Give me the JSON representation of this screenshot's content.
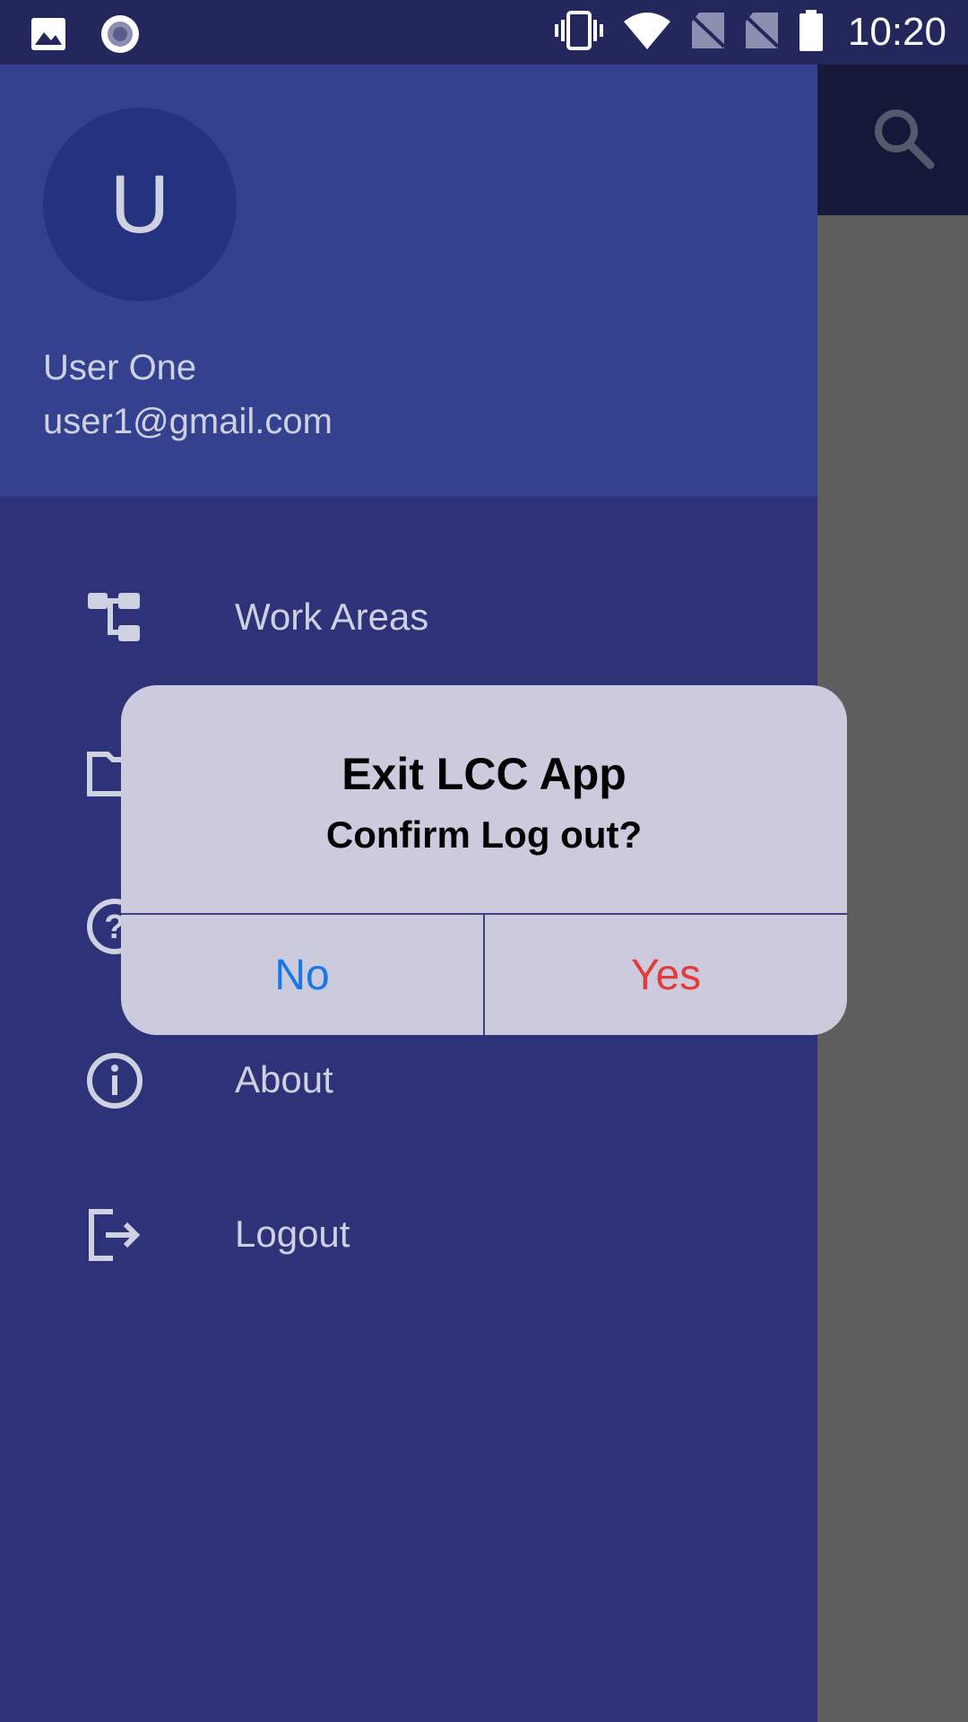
{
  "status_bar": {
    "time": "10:20",
    "icons": [
      "image-icon",
      "record-icon",
      "vibrate-icon",
      "wifi-icon",
      "no-sim-icon",
      "no-sim-icon",
      "battery-icon"
    ]
  },
  "app_bar": {
    "search_icon": "search-icon"
  },
  "drawer": {
    "avatar_letter": "U",
    "user_name": "User One",
    "user_email": "user1@gmail.com",
    "items": [
      {
        "label": "Work Areas",
        "icon": "tree-icon"
      },
      {
        "label": "",
        "icon": "folder-icon"
      },
      {
        "label": "",
        "icon": "help-icon"
      },
      {
        "label": "About",
        "icon": "info-icon"
      },
      {
        "label": "Logout",
        "icon": "logout-icon"
      }
    ]
  },
  "dialog": {
    "title": "Exit LCC App",
    "message": "Confirm Log out?",
    "no_label": "No",
    "yes_label": "Yes",
    "no_color": "#1677e8",
    "yes_color": "#e53a3a"
  },
  "colors": {
    "status_bar": "#23275c",
    "drawer": "#2e3279",
    "drawer_header": "#33418f",
    "dialog_bg": "#cbcbdd"
  }
}
